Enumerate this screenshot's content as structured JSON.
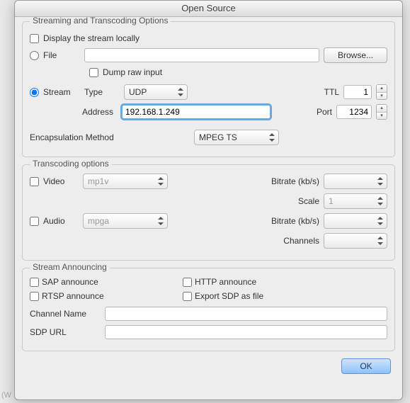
{
  "window": {
    "title": "Open Source"
  },
  "streaming": {
    "title": "Streaming and Transcoding Options",
    "display_locally": "Display the stream locally",
    "file": "File",
    "browse": "Browse...",
    "dump_raw": "Dump raw input",
    "stream": "Stream",
    "type": "Type",
    "type_value": "UDP",
    "ttl": "TTL",
    "ttl_value": "1",
    "address": "Address",
    "address_value": "192.168.1.249",
    "port": "Port",
    "port_value": "1234",
    "encaps": "Encapsulation Method",
    "encaps_value": "MPEG TS"
  },
  "transcoding": {
    "title": "Transcoding options",
    "video": "Video",
    "video_codec": "mp1v",
    "bitrate": "Bitrate (kb/s)",
    "scale": "Scale",
    "scale_value": "1",
    "audio": "Audio",
    "audio_codec": "mpga",
    "channels": "Channels"
  },
  "announces": {
    "title": "Stream Announcing",
    "sap": "SAP announce",
    "rtsp": "RTSP announce",
    "http": "HTTP announce",
    "export_sdp": "Export SDP as file",
    "channel_name": "Channel Name",
    "sdp_url": "SDP URL"
  },
  "footer": {
    "ok": "OK"
  },
  "bg": {
    "char": "(W"
  }
}
